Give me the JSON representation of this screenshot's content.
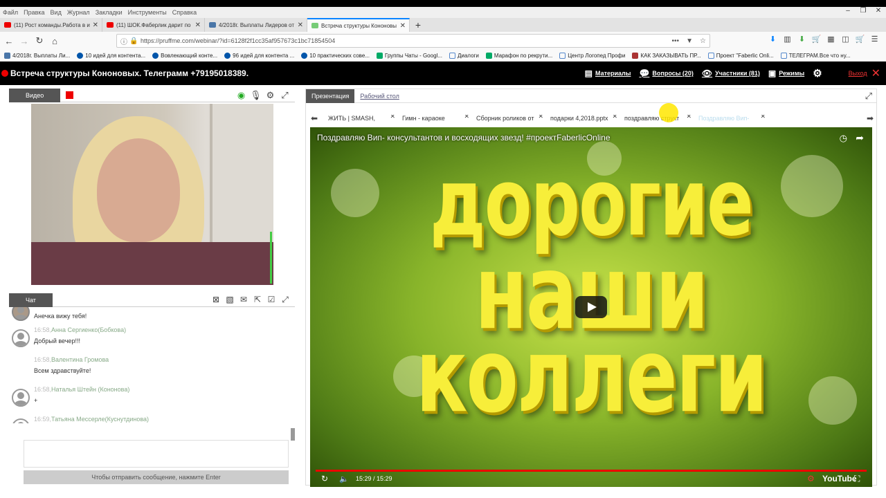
{
  "menubar": [
    "Файл",
    "Правка",
    "Вид",
    "Журнал",
    "Закладки",
    "Инструменты",
    "Справка"
  ],
  "tabs": [
    {
      "title": "(11) Рост команды.Работа в и",
      "fav": "#e00"
    },
    {
      "title": "(11) ШОК.Фаберлик дарит по",
      "fav": "#e00"
    },
    {
      "title": "4/2018г. Выплаты Лидеров от",
      "fav": "#4a76a8"
    },
    {
      "title": "Встреча структуры Кононовы",
      "fav": "#7c7"
    }
  ],
  "url": "https://pruffme.com/webinar/?id=6128f2f1cc35af957673c1bc71854504",
  "bookmarks": [
    {
      "label": "4/2018г. Выплаты Ли...",
      "color": "#4a76a8"
    },
    {
      "label": "10 идей для контента...",
      "color": "#05a"
    },
    {
      "label": "Вовлекающий конте...",
      "color": "#05a"
    },
    {
      "label": "96 идей для контента ...",
      "color": "#05a"
    },
    {
      "label": "10 практических сове...",
      "color": "#05a"
    },
    {
      "label": "Группы Чаты - Googl...",
      "color": "#0a6"
    },
    {
      "label": "Диалоги",
      "color": "#58c"
    },
    {
      "label": "Марафон по рекрути...",
      "color": "#0a6"
    },
    {
      "label": "Центр Логопед Профи",
      "color": "#58c"
    },
    {
      "label": "КАК ЗАКАЗЫВАТЬ ПР...",
      "color": "#a33"
    },
    {
      "label": "Проект \"Faberlic Onli...",
      "color": "#58c"
    },
    {
      "label": "ТЕЛЕГРАМ.Все что ну...",
      "color": "#58c"
    }
  ],
  "app": {
    "title": "Встреча структуры Кононовых. Телеграмм +79195018389.",
    "nav": [
      {
        "label": "Материалы",
        "icon": "▤"
      },
      {
        "label": "Вопросы (20)",
        "icon": "●"
      },
      {
        "label": "Участники (81)",
        "icon": "◉"
      },
      {
        "label": "Режимы",
        "icon": "▣"
      }
    ],
    "exit": "Выход"
  },
  "video_panel": {
    "tab": "Видео"
  },
  "chat": {
    "tab": "Чат",
    "messages": [
      {
        "time": "",
        "author": "",
        "text": "Анечка вижу тебя!"
      },
      {
        "time": "16:58,",
        "author": "Анна Сергиенко(Бобкова)",
        "text": "Добрый вечер!!!"
      },
      {
        "time": "16:58,",
        "author": "Валентина Громова",
        "text": "Всем здравствуйте!"
      },
      {
        "time": "16:58,",
        "author": "Наталья Штейн (Кононова)",
        "text": "+"
      },
      {
        "time": "16:59,",
        "author": "Татьяна Мессерле(Куснутдинова)",
        "text": "+++"
      }
    ],
    "send_hint": "Чтобы отправить сообщение, нажмите Enter"
  },
  "presentation": {
    "tab_active": "Презентация",
    "tab_other": "Рабочий стол",
    "files": [
      "ЖИТЬ | SMASH,",
      "Гимн - караоке",
      "Сборник роликов от",
      "подарки 4,2018.pptx",
      "поздравляю структ",
      "Поздравляю Вип-"
    ]
  },
  "player": {
    "title": "Поздравляю Вип- консультантов и восходящих звезд! #проектFaberlicOnline",
    "line1": "дорогие",
    "line2": "наши",
    "line3": "коллеги",
    "time": "15:29 / 15:29",
    "brand": "YouTube",
    "progress": 1.0
  }
}
